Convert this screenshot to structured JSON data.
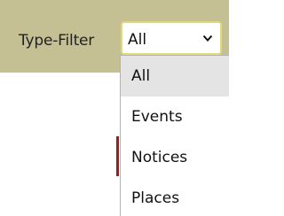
{
  "filter": {
    "label": "Type-Filter",
    "selected_value": "All",
    "chevron_icon": "chevron-down-icon",
    "options": [
      "All",
      "Events",
      "Notices",
      "Places"
    ],
    "highlighted_index": 0
  },
  "colors": {
    "filter_bar_bg": "#c4c093",
    "select_border": "#e2d97a",
    "highlight_bg": "#e4e4e4",
    "side_mark": "#9e1b1b"
  }
}
